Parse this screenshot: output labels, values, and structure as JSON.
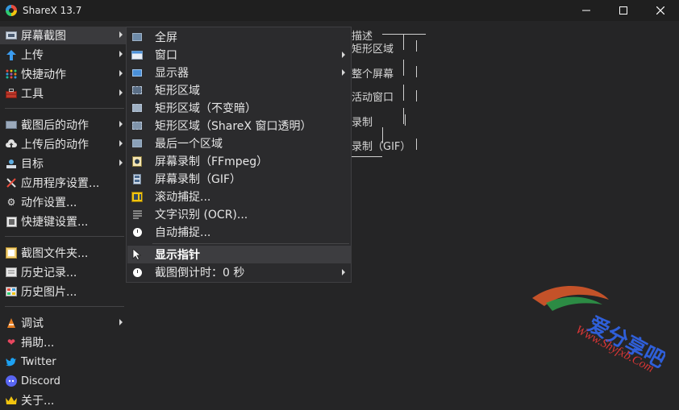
{
  "window": {
    "title": "ShareX 13.7",
    "controls": {
      "minimize_icon": "minimize-icon",
      "maximize_icon": "maximize-icon",
      "close_icon": "close-icon"
    }
  },
  "main_menu": {
    "items": [
      {
        "label": "屏幕截图",
        "icon": "screen-capture-icon",
        "has_submenu": true
      },
      {
        "label": "上传",
        "icon": "upload-arrow-icon",
        "has_submenu": true
      },
      {
        "label": "快捷动作",
        "icon": "quick-actions-icon",
        "has_submenu": true
      },
      {
        "label": "工具",
        "icon": "toolbox-icon",
        "has_submenu": true
      },
      {
        "label": "截图后的动作",
        "icon": "after-capture-icon",
        "has_submenu": true
      },
      {
        "label": "上传后的动作",
        "icon": "after-upload-icon",
        "has_submenu": true
      },
      {
        "label": "目标",
        "icon": "destinations-icon",
        "has_submenu": true
      },
      {
        "label": "应用程序设置...",
        "icon": "application-settings-icon",
        "has_submenu": false
      },
      {
        "label": "动作设置...",
        "icon": "task-settings-gear-icon",
        "has_submenu": false
      },
      {
        "label": "快捷键设置...",
        "icon": "hotkey-settings-icon",
        "has_submenu": false
      },
      {
        "label": "截图文件夹...",
        "icon": "screenshots-folder-icon",
        "has_submenu": false
      },
      {
        "label": "历史记录...",
        "icon": "history-icon",
        "has_submenu": false
      },
      {
        "label": "历史图片...",
        "icon": "image-history-icon",
        "has_submenu": false
      },
      {
        "label": "调试",
        "icon": "debug-cone-icon",
        "has_submenu": true
      },
      {
        "label": "捐助...",
        "icon": "donate-heart-icon",
        "has_submenu": false
      },
      {
        "label": "Twitter",
        "icon": "twitter-icon",
        "has_submenu": false
      },
      {
        "label": "Discord",
        "icon": "discord-icon",
        "has_submenu": false
      },
      {
        "label": "关于...",
        "icon": "about-crown-icon",
        "has_submenu": false
      }
    ]
  },
  "capture_submenu": {
    "items": [
      {
        "label": "全屏",
        "icon": "fullscreen-icon",
        "has_submenu": false
      },
      {
        "label": "窗口",
        "icon": "window-icon",
        "has_submenu": true
      },
      {
        "label": "显示器",
        "icon": "monitor-icon",
        "has_submenu": true
      },
      {
        "label": "矩形区域",
        "icon": "rectangle-region-icon",
        "has_submenu": false
      },
      {
        "label": "矩形区域（不变暗）",
        "icon": "rectangle-light-icon",
        "has_submenu": false
      },
      {
        "label": "矩形区域（ShareX 窗口透明）",
        "icon": "rectangle-transparent-icon",
        "has_submenu": false
      },
      {
        "label": "最后一个区域",
        "icon": "last-region-icon",
        "has_submenu": false
      },
      {
        "label": "屏幕录制（FFmpeg）",
        "icon": "screen-record-icon",
        "has_submenu": false
      },
      {
        "label": "屏幕录制（GIF）",
        "icon": "screen-record-gif-icon",
        "has_submenu": false
      },
      {
        "label": "滚动捕捉...",
        "icon": "scrolling-capture-icon",
        "has_submenu": false
      },
      {
        "label": "文字识别 (OCR)...",
        "icon": "ocr-icon",
        "has_submenu": false
      },
      {
        "label": "自动捕捉...",
        "icon": "auto-capture-clock-icon",
        "has_submenu": false
      },
      {
        "label": "显示指针",
        "icon": "cursor-icon",
        "has_submenu": false,
        "checked": true
      },
      {
        "label": "截图倒计时：0 秒",
        "icon": "countdown-clock-icon",
        "has_submenu": true
      }
    ]
  },
  "background_preview": {
    "lines": [
      "描述",
      "矩形区域",
      "整个屏幕",
      "活动窗口",
      "录制",
      "录制（GIF）"
    ]
  },
  "watermark": {
    "line1": "爱分享吧",
    "line2": "Www.Shyfxb.Com"
  },
  "colors": {
    "background": "#252526",
    "titlebar": "#1f1f1f",
    "submenu": "#2b2b2d",
    "hover": "#3a3a3d"
  }
}
